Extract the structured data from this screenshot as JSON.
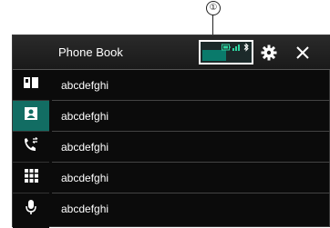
{
  "callout": {
    "number": "①"
  },
  "header": {
    "title": "Phone Book"
  },
  "status_icons": [
    "phone-battery-icon",
    "signal-icon",
    "bluetooth-icon"
  ],
  "sidebar": {
    "items": [
      {
        "icon": "phone-book-icon",
        "active": false
      },
      {
        "icon": "contact-card-icon",
        "active": true
      },
      {
        "icon": "recent-calls-icon",
        "active": false
      },
      {
        "icon": "keypad-icon",
        "active": false
      },
      {
        "icon": "microphone-icon",
        "active": false
      }
    ]
  },
  "contacts": [
    {
      "name": "abcdefghi"
    },
    {
      "name": "abcdefghi"
    },
    {
      "name": "abcdefghi"
    },
    {
      "name": "abcdefghi"
    },
    {
      "name": "abcdefghi"
    }
  ],
  "colors": {
    "accent": "#126d63",
    "background": "#0b0b0b",
    "text": "#ffffff"
  }
}
